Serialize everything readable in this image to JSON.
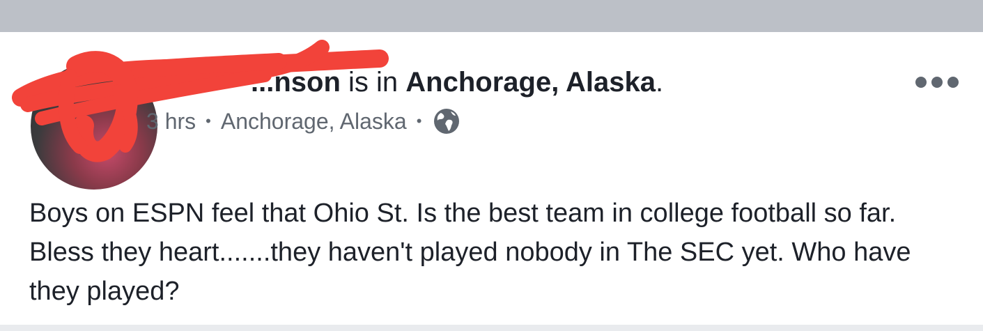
{
  "post": {
    "author_fragment": "...nson",
    "checkin_prefix": "is in",
    "location": "Anchorage, Alaska",
    "location_suffix": ".",
    "time": "3 hrs",
    "meta_location": "Anchorage, Alaska",
    "separator": "•",
    "privacy_icon": "globe-icon",
    "more_icon": "more-options-icon",
    "body": "Boys on ESPN feel that Ohio St. Is the best team in college football so far. Bless they heart.......they haven't played nobody in The SEC yet. Who have they played?"
  },
  "colors": {
    "top_bar": "#bcc0c7",
    "text_primary": "#1d2129",
    "text_secondary": "#606770",
    "redaction": "#f2433a"
  }
}
